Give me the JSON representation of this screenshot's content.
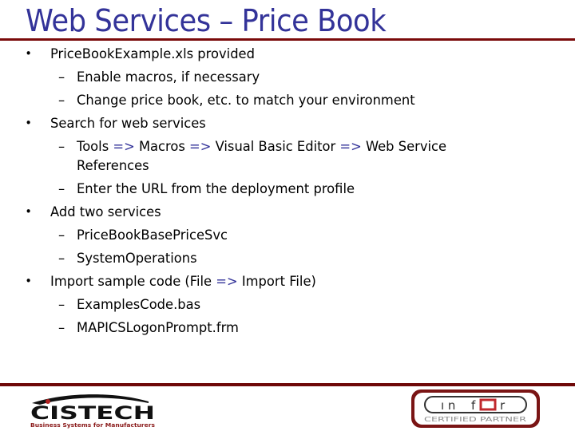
{
  "slide": {
    "title": "Web Services – Price Book",
    "bullets": [
      {
        "text": "PriceBookExample.xls provided",
        "subitems": [
          {
            "parts": [
              "Enable macros, if necessary"
            ]
          },
          {
            "parts": [
              "Change price book, etc. to match your environment"
            ]
          }
        ]
      },
      {
        "text": "Search for web services",
        "subitems": [
          {
            "parts": [
              "Tools",
              "Macros",
              "Visual Basic Editor",
              "Web Service"
            ],
            "continuation": "References"
          },
          {
            "parts": [
              "Enter the URL from the deployment profile"
            ]
          }
        ]
      },
      {
        "text": "Add two services",
        "subitems": [
          {
            "parts": [
              "PriceBookBasePriceSvc"
            ]
          },
          {
            "parts": [
              "SystemOperations"
            ]
          }
        ]
      },
      {
        "text_parts": [
          "Import sample code (File",
          "Import File)"
        ],
        "subitems": [
          {
            "parts": [
              "ExamplesCode.bas"
            ]
          },
          {
            "parts": [
              "MAPICSLogonPrompt.frm"
            ]
          }
        ]
      }
    ],
    "arrow_symbol": "=>",
    "bullet_symbol": "•",
    "dash_symbol": "–"
  },
  "footer": {
    "left_logo": {
      "name": "CISTECH",
      "tagline": "Business Systems for Manufacturers"
    },
    "right_logo": {
      "name": "infor",
      "tagline": "CERTIFIED PARTNER"
    }
  },
  "colors": {
    "title": "#333399",
    "rule": "#7a0a0a",
    "arrow": "#333399",
    "infor_accent": "#c0282d"
  }
}
